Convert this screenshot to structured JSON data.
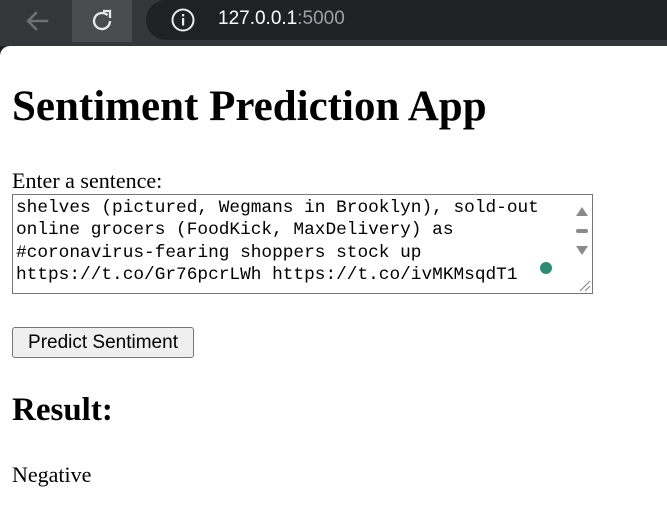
{
  "browser": {
    "url_host": "127.0.0.1",
    "url_port": ":5000"
  },
  "page": {
    "title": "Sentiment Prediction App",
    "input_label": "Enter a sentence:",
    "input_value": "...supermarket shelves empty as panic buying spreads, with empty\nshelves (pictured, Wegmans in Brooklyn), sold-out\nonline grocers (FoodKick, MaxDelivery) as\n#coronavirus-fearing shoppers stock up\nhttps://t.co/Gr76pcrLWh https://t.co/ivMKMsqdT1",
    "predict_button_label": "Predict Sentiment",
    "result_heading": "Result:",
    "result_value": "Negative"
  },
  "icons": {
    "back": "back-arrow-icon",
    "reload": "reload-icon",
    "info": "info-icon"
  },
  "colors": {
    "browser_bar": "#35363a",
    "address_bar": "#202124",
    "grammar_dot": "#2e8b74"
  }
}
